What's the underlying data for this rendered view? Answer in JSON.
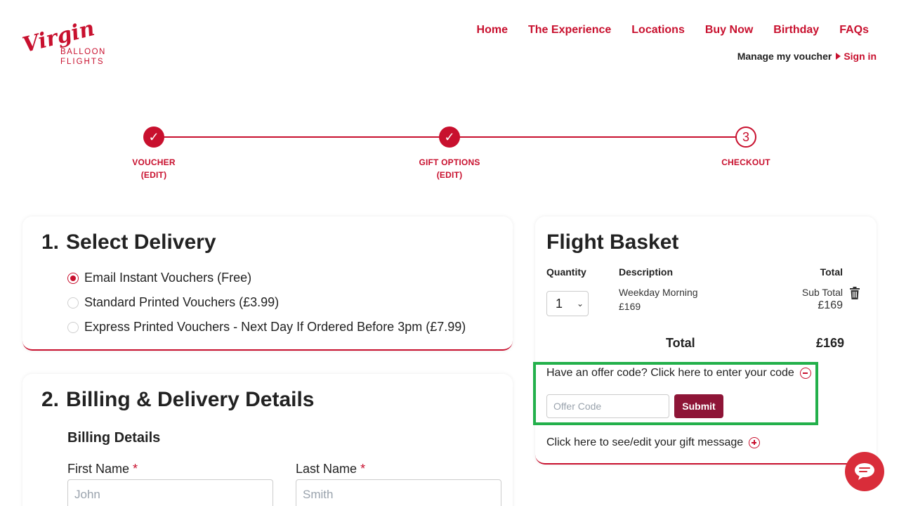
{
  "brand": {
    "logo_script": "Virgin",
    "logo_line1": "BALLOON",
    "logo_line2": "FLIGHTS",
    "accent_color": "#c8102e",
    "highlight_color": "#23b04b"
  },
  "nav": {
    "items": [
      "Home",
      "The Experience",
      "Locations",
      "Buy Now",
      "Birthday",
      "FAQs"
    ],
    "manage_label": "Manage my voucher",
    "signin_label": "Sign in"
  },
  "stepper": {
    "steps": [
      {
        "label": "VOUCHER",
        "sub": "(EDIT)",
        "status": "done",
        "icon": "✓"
      },
      {
        "label": "GIFT OPTIONS",
        "sub": "(EDIT)",
        "status": "done",
        "icon": "✓"
      },
      {
        "label": "CHECKOUT",
        "sub": "",
        "status": "current",
        "icon": "3"
      }
    ]
  },
  "delivery": {
    "num": "1.",
    "title": "Select Delivery",
    "options": [
      {
        "label": "Email Instant Vouchers (Free)",
        "checked": true
      },
      {
        "label": "Standard Printed Vouchers (£3.99)",
        "checked": false
      },
      {
        "label": "Express Printed Vouchers - Next Day If Ordered Before 3pm (£7.99)",
        "checked": false
      }
    ]
  },
  "billing": {
    "num": "2.",
    "title": "Billing & Delivery Details",
    "subtitle": "Billing Details",
    "first_name_label": "First Name",
    "first_name_placeholder": "John",
    "last_name_label": "Last Name",
    "last_name_placeholder": "Smith",
    "required_mark": "*"
  },
  "basket": {
    "title": "Flight Basket",
    "col_quantity": "Quantity",
    "col_description": "Description",
    "col_total": "Total",
    "quantity": "1",
    "item_name": "Weekday Morning",
    "item_price": "£169",
    "subtotal_label": "Sub Total",
    "subtotal_amount": "£169",
    "total_label": "Total",
    "total_amount": "£169",
    "offer_prompt": "Have an offer code? Click here to enter your code",
    "offer_placeholder": "Offer Code",
    "submit_label": "Submit",
    "gift_prompt": "Click here to see/edit your gift message"
  }
}
